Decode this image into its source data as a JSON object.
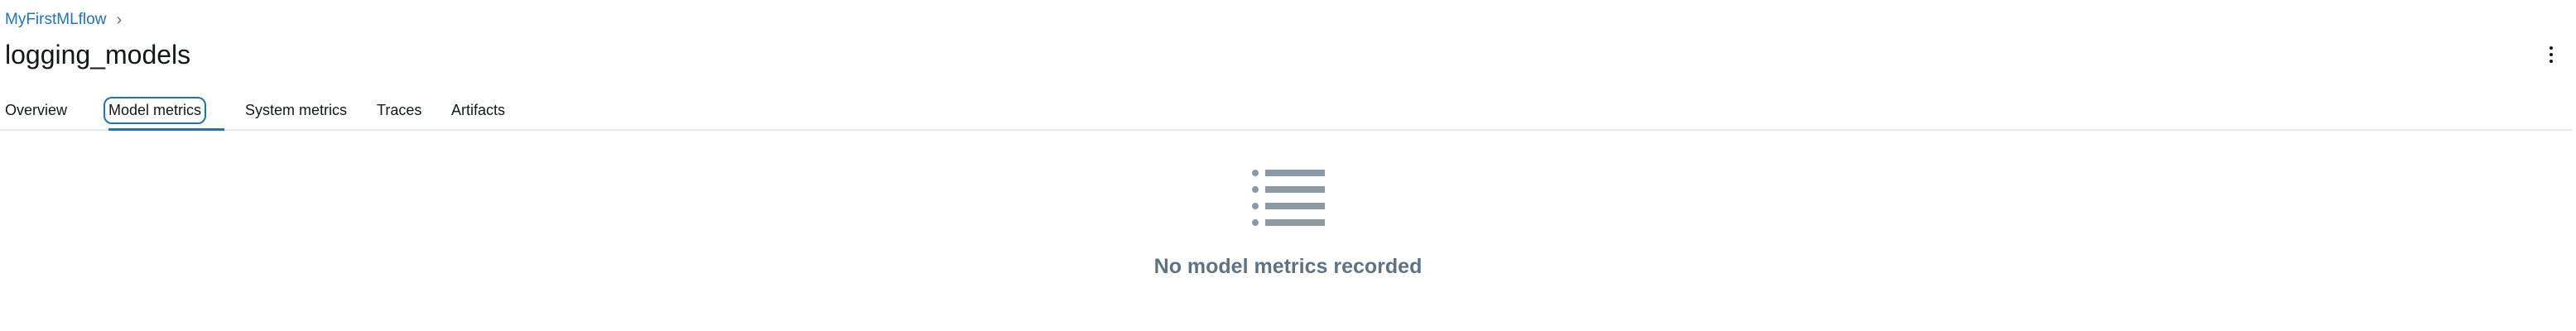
{
  "breadcrumb": {
    "experiment_name": "MyFirstMLflow",
    "separator": "›"
  },
  "header": {
    "title": "logging_models",
    "more_icon": "kebab-vertical-icon"
  },
  "tabs": [
    {
      "label": "Overview",
      "active": false
    },
    {
      "label": "Model metrics",
      "active": true
    },
    {
      "label": "System metrics",
      "active": false
    },
    {
      "label": "Traces",
      "active": false
    },
    {
      "label": "Artifacts",
      "active": false
    }
  ],
  "empty_state": {
    "icon": "list-icon",
    "message": "No model metrics recorded"
  },
  "colors": {
    "link": "#2272b4",
    "muted": "#5f7281",
    "icon": "#8d9aa6",
    "border": "#e8ecf0"
  }
}
